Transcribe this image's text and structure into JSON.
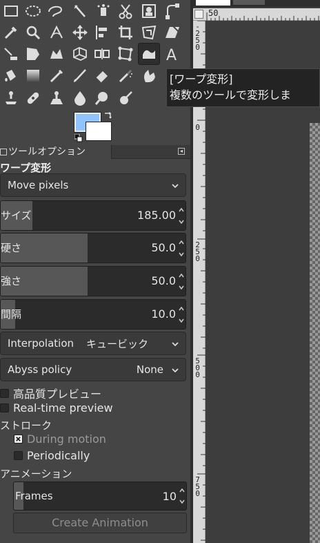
{
  "toolbox": {
    "active_tool": "warp-transform",
    "colors": {
      "foreground": "#8fc4ff",
      "background": "#ffffff"
    }
  },
  "tooltip": {
    "title": "[ワープ変形]",
    "description": "複数のツールで変形しま"
  },
  "options": {
    "tab_label": "ツールオプション",
    "tool_title": "ワープ変形",
    "behavior": "Move pixels",
    "size": {
      "label": "サイズ",
      "value": "185.00",
      "level": 0.17
    },
    "hardness": {
      "label": "硬さ",
      "value": "50.0",
      "level": 0.47
    },
    "strength": {
      "label": "強さ",
      "value": "50.0",
      "level": 0.47
    },
    "spacing": {
      "label": "間隔",
      "value": "10.0",
      "level": 0.08
    },
    "interpolation": {
      "label": "Interpolation",
      "value": "キュービック"
    },
    "abyss": {
      "label": "Abyss policy",
      "value": "None"
    },
    "hq_preview": {
      "label": "高品質プレビュー",
      "checked": false
    },
    "realtime_preview": {
      "label": "Real-time preview",
      "checked": false
    },
    "stroke_section": "ストローク",
    "during_motion": {
      "label": "During motion",
      "checked": true
    },
    "periodically": {
      "label": "Periodically",
      "checked": false
    },
    "animation_section": "アニメーション",
    "frames": {
      "label": "Frames",
      "value": "10"
    },
    "create_animation": "Create Animation"
  },
  "rulers": {
    "horizontal_label": "50",
    "vertical_labels": [
      "-250",
      "0",
      "250",
      "500",
      "750"
    ]
  },
  "colors": {
    "panel_bg": "#454545",
    "field_bg": "#2b2b2b",
    "slider_fill": "#575757",
    "tooltip_bg": "#232323"
  }
}
